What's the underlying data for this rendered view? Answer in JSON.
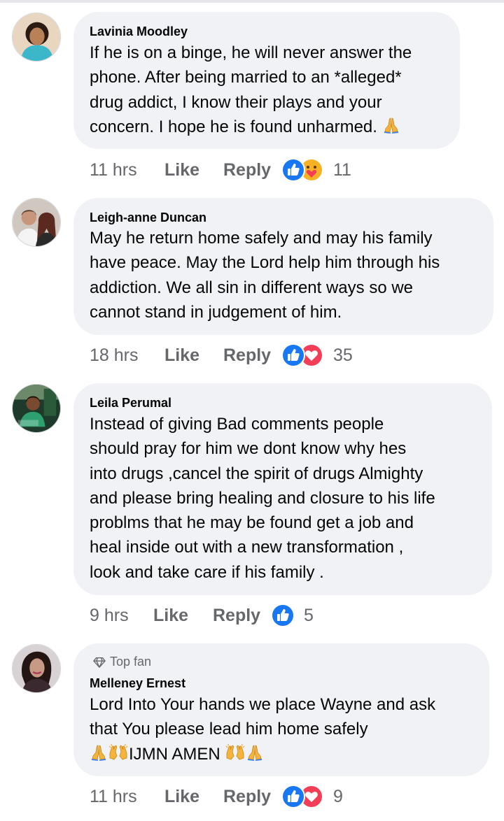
{
  "comments": [
    {
      "name": "Lavinia Moodley",
      "text": "If he is on a binge, he will never answer the\nphone. After being married to an *alleged*\ndrug addict, I know their plays and your\nconcern. I hope he is found unharmed.",
      "time": "11 hrs",
      "like": "Like",
      "reply": "Reply",
      "reactions": [
        "like-icon",
        "care-icon"
      ],
      "reaction_count": "11"
    },
    {
      "name": "Leigh-anne Duncan",
      "text": "May he return home safely and may his family\nhave peace. May the Lord help him through his\naddiction. We all sin in different ways so we\ncannot stand in judgement of him.",
      "time": "18 hrs",
      "like": "Like",
      "reply": "Reply",
      "reactions": [
        "like-icon",
        "love-icon"
      ],
      "reaction_count": "35"
    },
    {
      "name": "Leila Perumal",
      "text": "Instead of giving Bad comments people\nshould pray for him we dont know why hes\ninto drugs ,cancel the spirit of drugs Almighty\nand please bring healing and closure to his life\nproblms that he may be found   get a job and\nheal inside out with a new transformation ,\nlook and take care if his family .",
      "time": "9 hrs",
      "like": "Like",
      "reply": "Reply",
      "reactions": [
        "like-icon"
      ],
      "reaction_count": "5"
    },
    {
      "badge": "Top fan",
      "name": "Melleney Ernest",
      "text": "Lord Into Your hands we place Wayne and ask\nthat You please lead him home safely",
      "text_tail": "IJMN AMEN",
      "time": "11 hrs",
      "like": "Like",
      "reply": "Reply",
      "reactions": [
        "like-icon",
        "love-icon"
      ],
      "reaction_count": "9"
    }
  ],
  "colors": {
    "like_blue": "#1877f2",
    "love_red": "#f33e58",
    "care_yellow": "#f7b125",
    "bubble_bg": "#f0f2f5",
    "meta_gray": "#65676b"
  }
}
